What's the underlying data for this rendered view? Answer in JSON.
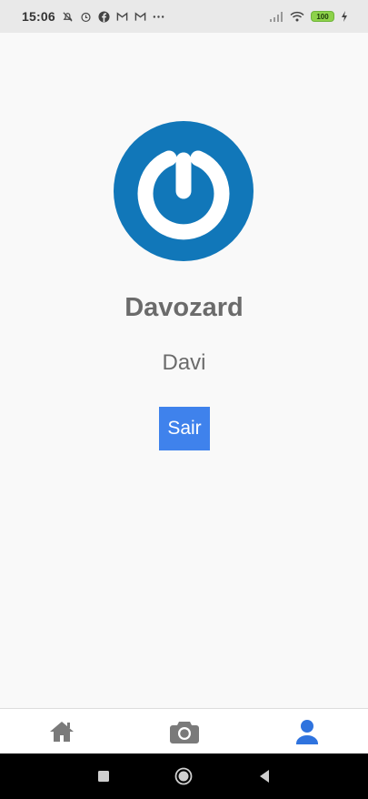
{
  "status_bar": {
    "time": "15:06",
    "battery": "100",
    "icons_left": [
      "mute-icon",
      "alarm-icon",
      "facebook-icon",
      "gmail-icon",
      "gmail-icon",
      "more-icon"
    ],
    "icons_right": [
      "signal-icon",
      "wifi-icon",
      "battery-icon",
      "charging-icon"
    ]
  },
  "profile": {
    "username": "Davozard",
    "name": "Davi",
    "avatar_icon": "power-logo-icon"
  },
  "actions": {
    "logout_label": "Sair"
  },
  "tab_bar": {
    "tabs": [
      {
        "icon": "home-icon",
        "active": false
      },
      {
        "icon": "camera-icon",
        "active": false
      },
      {
        "icon": "user-icon",
        "active": true
      }
    ],
    "active_color": "#2f73de",
    "inactive_color": "#7a7a7a"
  },
  "nav_bar": {
    "buttons": [
      "recents-button",
      "home-button",
      "back-button"
    ]
  },
  "colors": {
    "avatar_bg": "#1177b9",
    "button_bg": "#3f82ec"
  }
}
